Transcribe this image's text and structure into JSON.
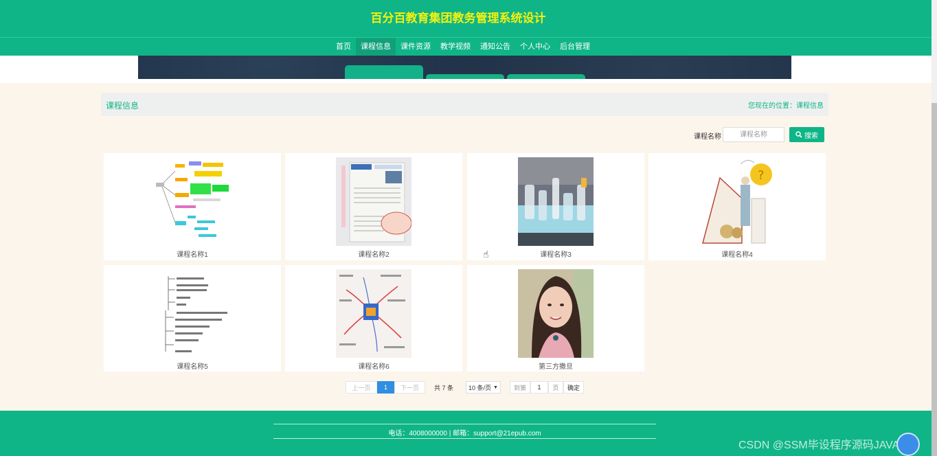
{
  "header": {
    "site_title": "百分百教育集团教务管理系统设计"
  },
  "nav": {
    "items": [
      {
        "label": "首页"
      },
      {
        "label": "课程信息",
        "active": true
      },
      {
        "label": "课件资源"
      },
      {
        "label": "教学视频"
      },
      {
        "label": "通知公告"
      },
      {
        "label": "个人中心"
      },
      {
        "label": "后台管理"
      }
    ]
  },
  "section": {
    "title": "课程信息",
    "breadcrumb": "您现在的位置：课程信息"
  },
  "search": {
    "label": "课程名称",
    "placeholder": "课程名称",
    "button_label": "搜索"
  },
  "courses": [
    {
      "name": "课程名称1",
      "image": "mind-map-colorful"
    },
    {
      "name": "课程名称2",
      "image": "textbook-page"
    },
    {
      "name": "课程名称3",
      "image": "lab-glassware-photo"
    },
    {
      "name": "课程名称4",
      "image": "illustration-book"
    },
    {
      "name": "课程名称5",
      "image": "outline-tree"
    },
    {
      "name": "课程名称6",
      "image": "mind-map-sketch"
    },
    {
      "name": "第三方撒旦",
      "image": "portrait-photo"
    }
  ],
  "pagination": {
    "prev_label": "上一页",
    "current_page": "1",
    "next_label": "下一页",
    "total_text": "共 7 条",
    "page_size": "10 条/页",
    "goto_label": "到第",
    "goto_value": "1",
    "page_unit": "页",
    "confirm_label": "确定"
  },
  "footer": {
    "contact": "电话：4008000000 | 邮箱：support@21epub.com"
  },
  "watermark": "CSDN @SSM毕设程序源码JAVA",
  "colors": {
    "primary": "#0fb587",
    "title_yellow": "#f3f10f",
    "page_bg": "#fcf5ec",
    "page_active": "#2f8fe0"
  }
}
